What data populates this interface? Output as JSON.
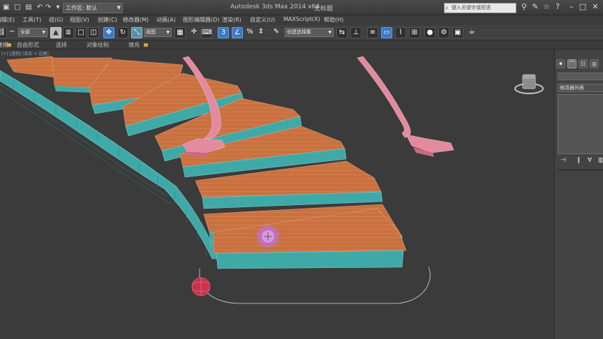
{
  "titlebar": {
    "workspace_label": "工作区: 默认",
    "app_title": "Autodesk 3ds Max  2014 x64",
    "file_name": "无标题",
    "search_placeholder": "键入关键字或短语"
  },
  "menu": {
    "items": [
      "编辑(E)",
      "工具(T)",
      "组(G)",
      "视图(V)",
      "创建(C)",
      "修改器(M)",
      "动画(A)",
      "图形编辑器(D)",
      "渲染(R)",
      "自定义(U)",
      "MAXScript(X)",
      "帮助(H)"
    ]
  },
  "toolbar": {
    "selection_filter": "全部",
    "reference_coord": "视图",
    "named_selection": "创建选择集"
  },
  "ribbon": {
    "tabs": [
      "建模",
      "自由形式",
      "选择",
      "对象绘制",
      "填充"
    ]
  },
  "viewport": {
    "label": "[+] [透视] [真实 + 边面]"
  },
  "command_panel": {
    "modifier_list_label": "修改器列表"
  },
  "colors": {
    "tread": "#c9713f",
    "riser": "#3fa9a8",
    "railing": "#e38a9e",
    "selection_sphere": "#c8324a",
    "gizmo": "#c070d8",
    "background": "#3b3b3b"
  }
}
